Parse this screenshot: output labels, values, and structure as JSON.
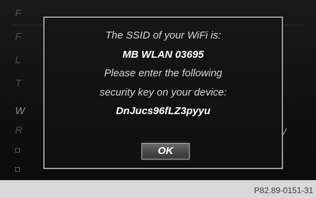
{
  "dialog": {
    "line1": "The SSID of your WiFi is:",
    "ssid": "MB WLAN 03695",
    "line3": "Please enter the following",
    "line4": "security key on your device:",
    "security_key": "DnJucs96fLZ3pyyu",
    "ok_label": "OK"
  },
  "background": {
    "right_text": "Key"
  },
  "footer": {
    "reference_code": "P82.89-0151-31"
  }
}
